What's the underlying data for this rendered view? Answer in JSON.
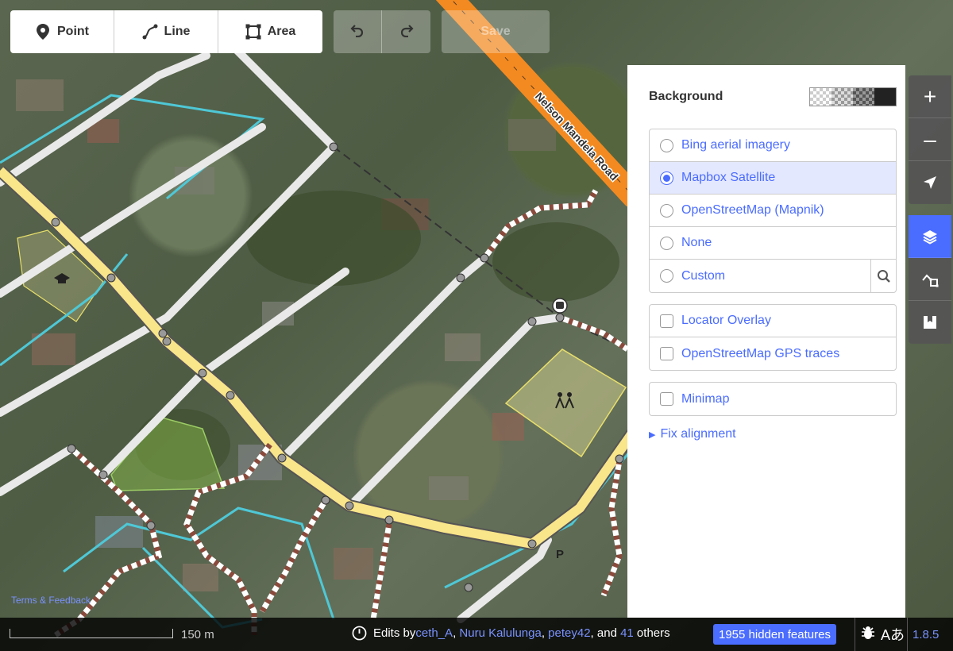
{
  "toolbar": {
    "modes": [
      {
        "label": "Point",
        "icon": "point-marker-icon"
      },
      {
        "label": "Line",
        "icon": "line-icon"
      },
      {
        "label": "Area",
        "icon": "area-icon"
      }
    ],
    "undo_icon": "undo-icon",
    "redo_icon": "redo-icon",
    "save_label": "Save"
  },
  "map": {
    "road_label": "Nelson Mandela Road",
    "parking_label": "P"
  },
  "background_pane": {
    "title": "Background",
    "imagery": [
      {
        "label": "Bing aerial imagery",
        "selected": false
      },
      {
        "label": "Mapbox Satellite",
        "selected": true
      },
      {
        "label": "OpenStreetMap (Mapnik)",
        "selected": false
      },
      {
        "label": "None",
        "selected": false
      },
      {
        "label": "Custom",
        "selected": false
      }
    ],
    "overlays": [
      {
        "label": "Locator Overlay"
      },
      {
        "label": "OpenStreetMap GPS traces"
      }
    ],
    "minimap": {
      "label": "Minimap"
    },
    "fix_alignment": "Fix alignment"
  },
  "footer": {
    "scale_label": "150 m",
    "terms": "Terms & Feedback",
    "edits_prefix": "Edits by ",
    "editors": [
      "ceth_A",
      "Nuru Kalulunga",
      "petey42"
    ],
    "and_text": ", and ",
    "others_count": "41",
    "others_text": " others",
    "hidden_features": "1955 hidden features",
    "version": "1.8.5",
    "help_icon_text": "Aあ"
  },
  "colors": {
    "accent": "#4a6cff",
    "primary_road": "#f9e58a",
    "trunk_road": "#f38a21",
    "path": "#8b4a3c",
    "water": "#4ec8d6"
  }
}
